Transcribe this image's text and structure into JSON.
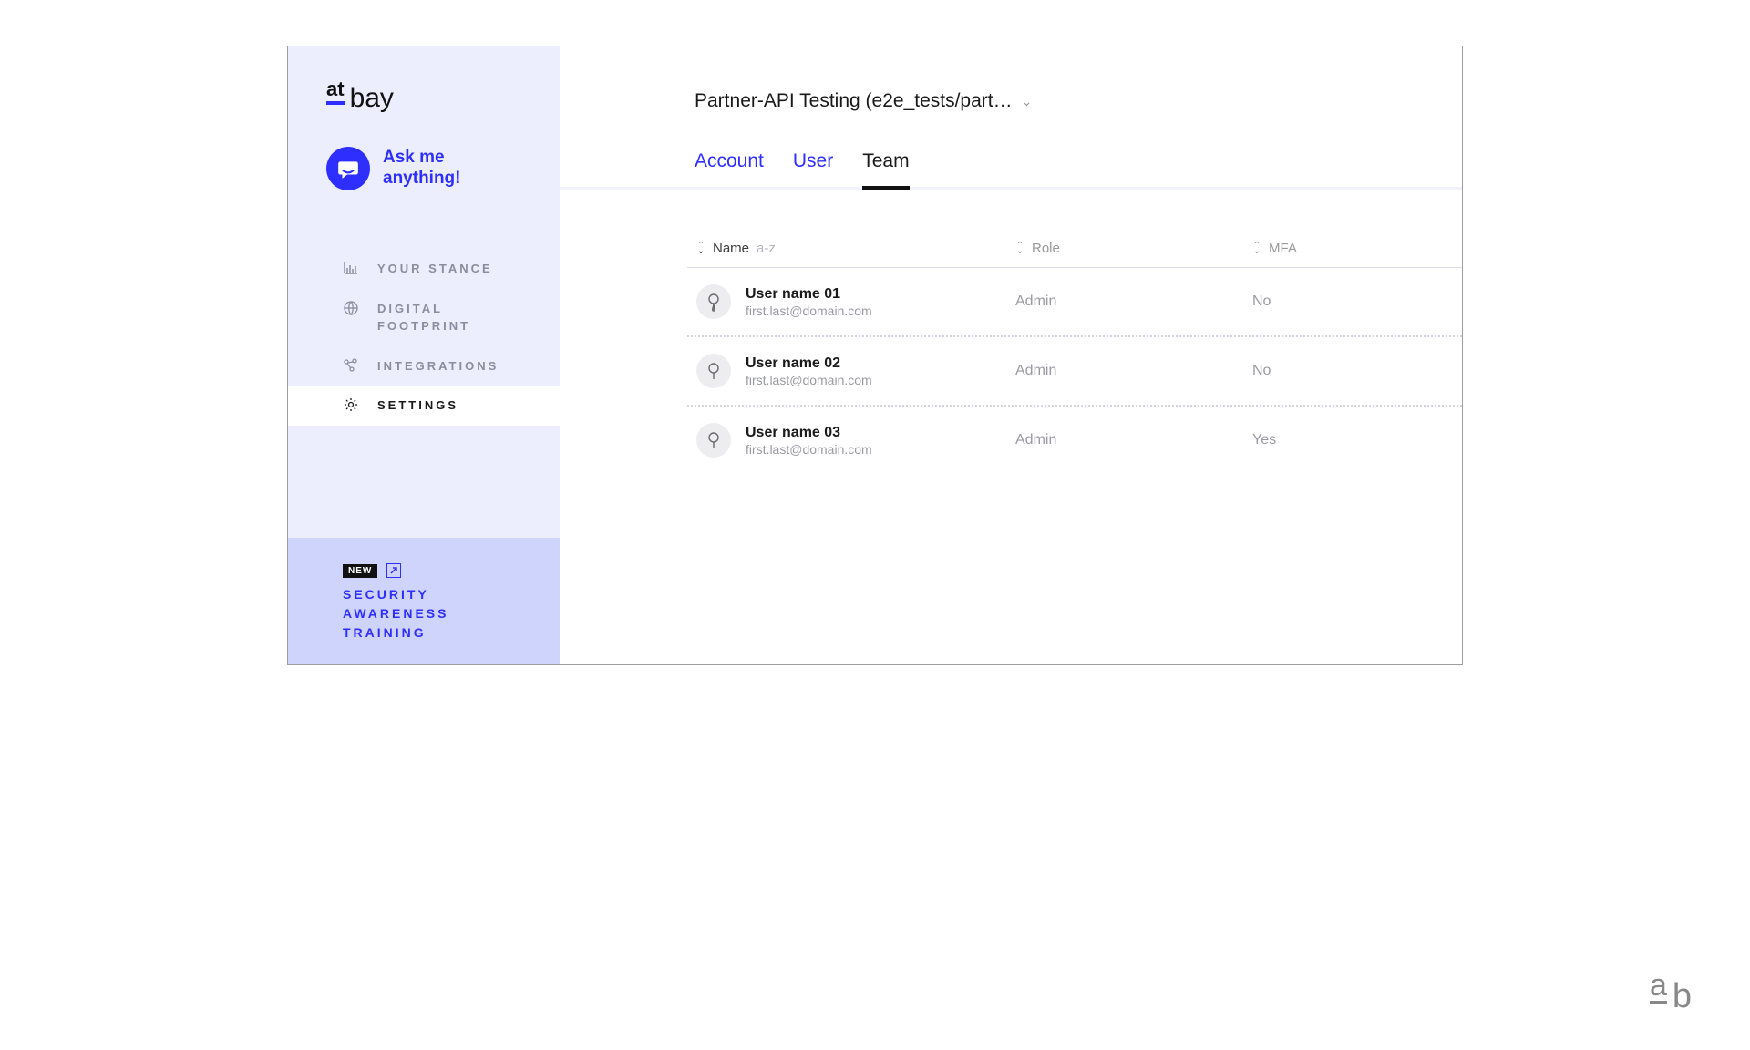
{
  "logo": {
    "part1": "at",
    "part2": "bay"
  },
  "ask": {
    "line1": "Ask me",
    "line2": "anything!"
  },
  "nav": {
    "items": [
      {
        "label": "YOUR STANCE"
      },
      {
        "label": "DIGITAL FOOTPRINT"
      },
      {
        "label": "INTEGRATIONS"
      },
      {
        "label": "SETTINGS"
      }
    ]
  },
  "promo": {
    "badge": "NEW",
    "line1": "SECURITY",
    "line2": "AWARENESS",
    "line3": "TRAINING"
  },
  "header": {
    "breadcrumb": "Partner-API Testing (e2e_tests/part…",
    "tabs": [
      {
        "label": "Account"
      },
      {
        "label": "User"
      },
      {
        "label": "Team"
      }
    ]
  },
  "table": {
    "columns": {
      "name": {
        "label": "Name",
        "hint": "a-z"
      },
      "role": {
        "label": "Role"
      },
      "mfa": {
        "label": "MFA"
      }
    },
    "rows": [
      {
        "name": "User name 01",
        "email": "first.last@domain.com",
        "role": "Admin",
        "mfa": "No"
      },
      {
        "name": "User name 02",
        "email": "first.last@domain.com",
        "role": "Admin",
        "mfa": "No"
      },
      {
        "name": "User name 03",
        "email": "first.last@domain.com",
        "role": "Admin",
        "mfa": "Yes"
      }
    ]
  },
  "footer_logo": {
    "a": "a",
    "b": "b"
  }
}
